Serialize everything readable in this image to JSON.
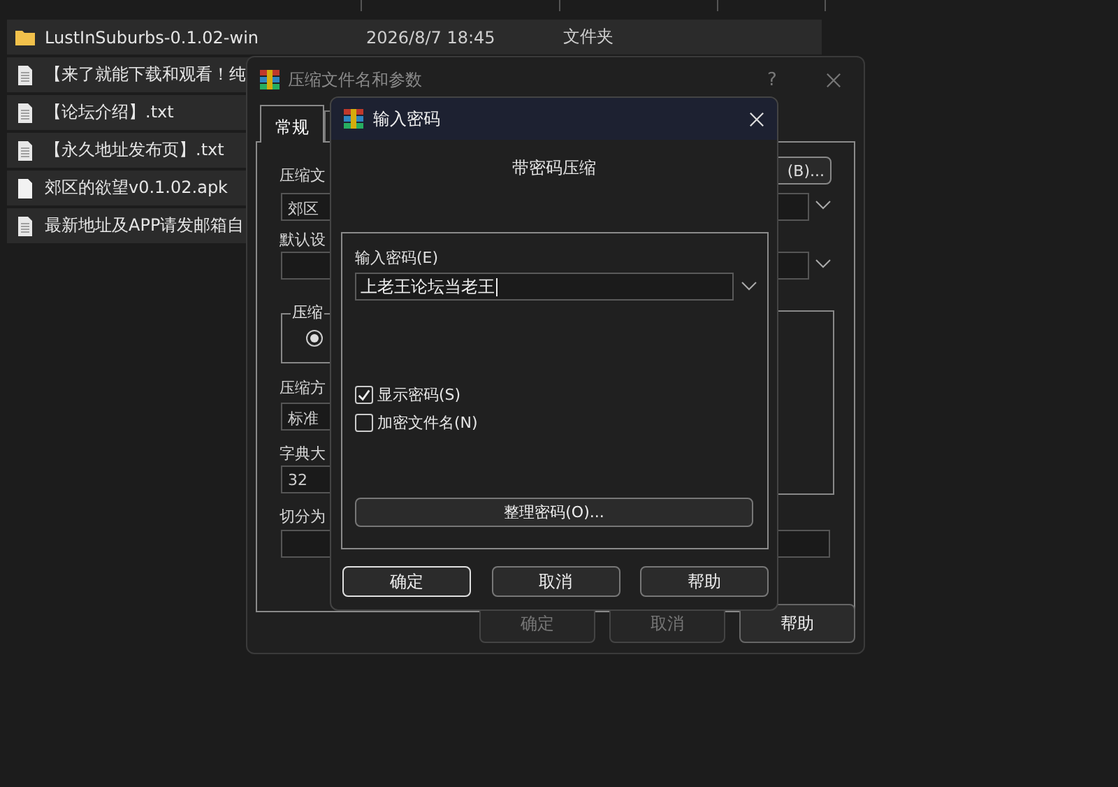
{
  "file_list": {
    "rows": [
      {
        "kind": "folder",
        "name": "LustInSuburbs-0.1.02-win",
        "date": "2026/8/7 18:45",
        "type": "文件夹"
      },
      {
        "kind": "document",
        "name": "【来了就能下载和观看！纯"
      },
      {
        "kind": "document",
        "name": "【论坛介绍】.txt"
      },
      {
        "kind": "document",
        "name": "【永久地址发布页】.txt"
      },
      {
        "kind": "file",
        "name": "郊区的欲望v0.1.02.apk"
      },
      {
        "kind": "document",
        "name": "最新地址及APP请发邮箱自"
      }
    ]
  },
  "archive_dialog": {
    "title": "压缩文件名和参数",
    "help": "?",
    "tabs": [
      {
        "label": "常规",
        "selected": true
      }
    ],
    "archive_name_label": "压缩文",
    "archive_name_value": "郊区",
    "browse_button": "(B)...",
    "profile_label": "默认设",
    "format_group_label": "压缩",
    "format_radio": {
      "selected": true
    },
    "method_label": "压缩方",
    "method_value": "标准",
    "dictionary_label": "字典大",
    "dictionary_value": "32",
    "split_label": "切分为",
    "buttons": [
      {
        "label": "确定",
        "disabled": true
      },
      {
        "label": "取消",
        "disabled": true
      },
      {
        "label": "帮助",
        "disabled": false
      }
    ]
  },
  "password_dialog": {
    "title": "输入密码",
    "heading": "带密码压缩",
    "password_label": "输入密码(E)",
    "password_value": "上老王论坛当老王",
    "options": [
      {
        "label": "显示密码(S)",
        "checked": true
      },
      {
        "label": "加密文件名(N)",
        "checked": false
      }
    ],
    "organize_button": "整理密码(O)...",
    "buttons": [
      {
        "label": "确定",
        "default": true
      },
      {
        "label": "取消",
        "default": false
      },
      {
        "label": "帮助",
        "default": false
      }
    ]
  }
}
